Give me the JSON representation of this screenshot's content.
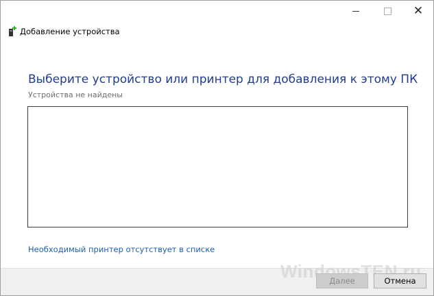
{
  "window": {
    "title": "Добавление устройства",
    "icon": "printer-add-icon"
  },
  "caption_buttons": {
    "minimize_icon": "minimize-icon",
    "maximize_icon": "maximize-icon",
    "close_glyph": "✕"
  },
  "main": {
    "heading": "Выберите устройство или принтер для добавления к этому ПК",
    "status": "Устройства не найдены",
    "device_list": [],
    "missing_printer_link": "Необходимый принтер отсутствует в списке"
  },
  "footer": {
    "next_label": "Далее",
    "next_enabled": false,
    "cancel_label": "Отмена",
    "watermark": "WindowsTEN.ru"
  },
  "colors": {
    "heading": "#1f3d8f",
    "link": "#1a5fb4",
    "icon_accent": "#2fb52f"
  }
}
